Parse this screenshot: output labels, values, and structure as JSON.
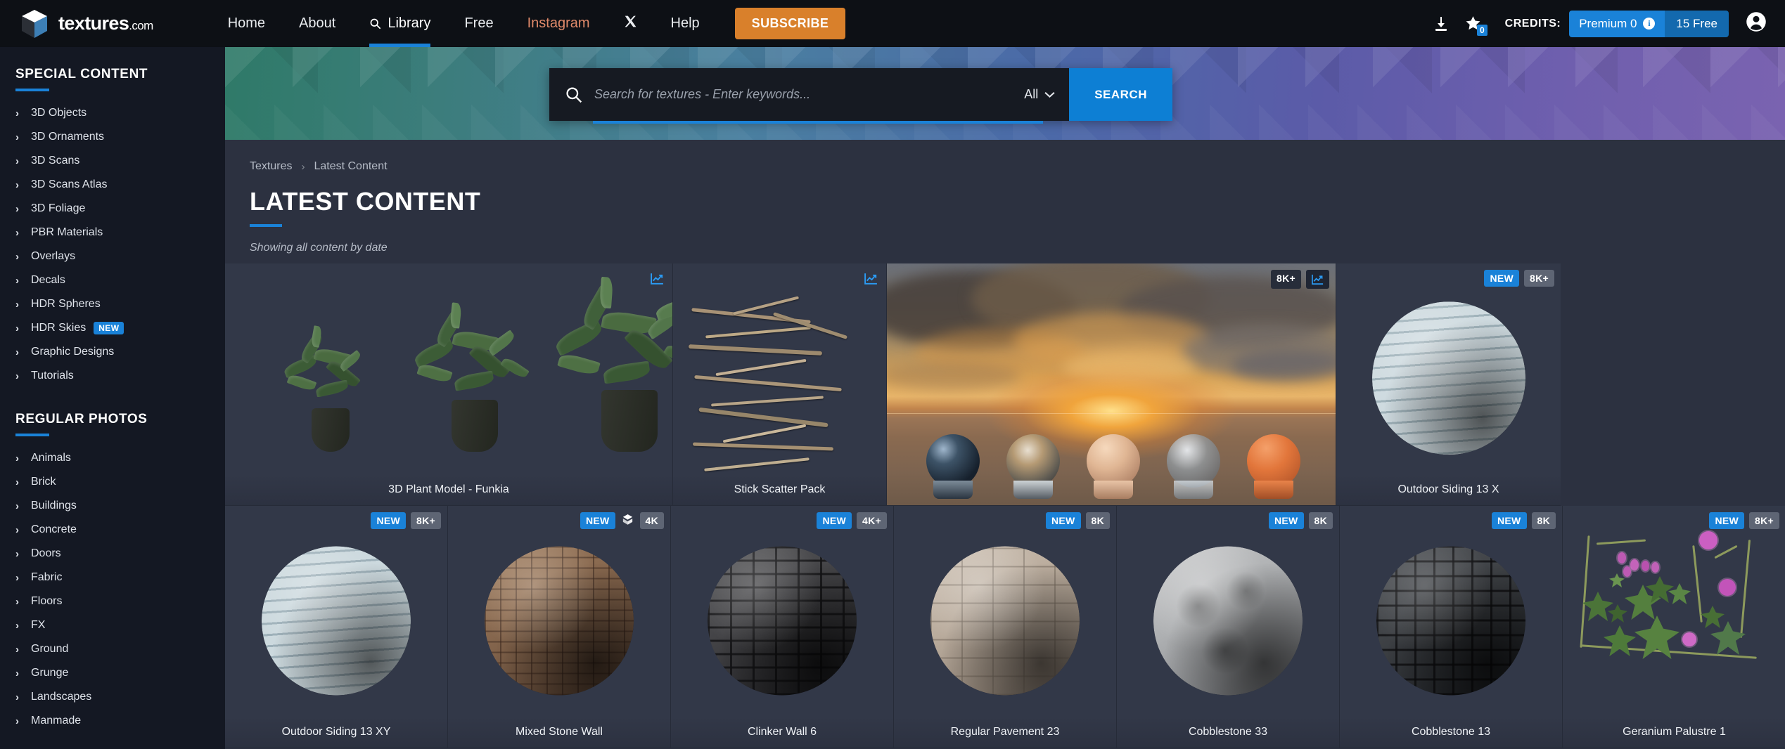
{
  "brand": {
    "name": "textures",
    "suffix": ".com",
    "logo_icon": "cube-logo-icon"
  },
  "nav": {
    "items": [
      {
        "label": "Home",
        "icon": null,
        "active": false
      },
      {
        "label": "About",
        "icon": null,
        "active": false
      },
      {
        "label": "Library",
        "icon": "search-icon",
        "active": true
      },
      {
        "label": "Free",
        "icon": null,
        "active": false
      },
      {
        "label": "Instagram",
        "icon": null,
        "active": false,
        "style": "instagram"
      },
      {
        "label": "",
        "icon": "x-twitter-icon",
        "active": false
      },
      {
        "label": "Help",
        "icon": null,
        "active": false
      }
    ],
    "subscribe_label": "SUBSCRIBE"
  },
  "header_right": {
    "download_icon": "download-icon",
    "favorites_icon": "star-icon",
    "favorites_count": "0",
    "credits_label": "CREDITS:",
    "premium_label": "Premium 0",
    "info_icon": "info-icon",
    "free_label": "15 Free",
    "account_icon": "account-icon"
  },
  "search": {
    "icon": "search-icon",
    "value": "",
    "placeholder": "Search for textures - Enter keywords...",
    "filter_label": "All",
    "filter_icon": "chevron-down-icon",
    "button_label": "SEARCH"
  },
  "sidebar": {
    "sections": [
      {
        "title": "SPECIAL CONTENT",
        "items": [
          {
            "label": "3D Objects"
          },
          {
            "label": "3D Ornaments"
          },
          {
            "label": "3D Scans"
          },
          {
            "label": "3D Scans Atlas"
          },
          {
            "label": "3D Foliage"
          },
          {
            "label": "PBR Materials"
          },
          {
            "label": "Overlays"
          },
          {
            "label": "Decals"
          },
          {
            "label": "HDR Spheres"
          },
          {
            "label": "HDR Skies",
            "tag": "NEW"
          },
          {
            "label": "Graphic Designs"
          },
          {
            "label": "Tutorials"
          }
        ]
      },
      {
        "title": "REGULAR PHOTOS",
        "items": [
          {
            "label": "Animals"
          },
          {
            "label": "Brick"
          },
          {
            "label": "Buildings"
          },
          {
            "label": "Concrete"
          },
          {
            "label": "Doors"
          },
          {
            "label": "Fabric"
          },
          {
            "label": "Floors"
          },
          {
            "label": "FX"
          },
          {
            "label": "Ground"
          },
          {
            "label": "Grunge"
          },
          {
            "label": "Landscapes"
          },
          {
            "label": "Manmade"
          }
        ]
      }
    ]
  },
  "breadcrumb": {
    "root": "Textures",
    "separator": "›",
    "current": "Latest Content"
  },
  "page": {
    "title": "LATEST CONTENT",
    "subtitle": "Showing all content by date"
  },
  "grid": {
    "row1": [
      {
        "title": "3D Plant Model - Funkia",
        "badges": [
          {
            "text": "",
            "type": "trend-icon"
          }
        ],
        "thumb": "plants"
      },
      {
        "title": "Stick Scatter Pack",
        "badges": [
          {
            "text": "",
            "type": "trend-icon"
          }
        ],
        "thumb": "sticks"
      },
      {
        "title": "",
        "badges": [
          {
            "text": "8K+",
            "type": "res"
          },
          {
            "text": "",
            "type": "trend-icon"
          }
        ],
        "thumb": "hdr-sky"
      },
      {
        "title": "Outdoor Siding 13 X",
        "badges": [
          {
            "text": "NEW",
            "type": "new"
          },
          {
            "text": "8K+",
            "type": "res"
          }
        ],
        "thumb": "sphere-siding"
      }
    ],
    "row2": [
      {
        "title": "Outdoor Siding 13 XY",
        "badges": [
          {
            "text": "NEW",
            "type": "new"
          },
          {
            "text": "8K+",
            "type": "res"
          }
        ],
        "thumb": "sphere-siding"
      },
      {
        "title": "Mixed Stone Wall",
        "badges": [
          {
            "text": "NEW",
            "type": "new"
          },
          {
            "text": "",
            "type": "material-icon"
          },
          {
            "text": "4K",
            "type": "res"
          }
        ],
        "thumb": "sphere-stone"
      },
      {
        "title": "Clinker Wall 6",
        "badges": [
          {
            "text": "NEW",
            "type": "new"
          },
          {
            "text": "4K+",
            "type": "res"
          }
        ],
        "thumb": "sphere-clinker"
      },
      {
        "title": "Regular Pavement 23",
        "badges": [
          {
            "text": "NEW",
            "type": "new"
          },
          {
            "text": "8K",
            "type": "res"
          }
        ],
        "thumb": "sphere-pavement"
      },
      {
        "title": "Cobblestone 33",
        "badges": [
          {
            "text": "NEW",
            "type": "new"
          },
          {
            "text": "8K",
            "type": "res"
          }
        ],
        "thumb": "sphere-cobble33"
      },
      {
        "title": "Cobblestone 13",
        "badges": [
          {
            "text": "NEW",
            "type": "new"
          },
          {
            "text": "8K",
            "type": "res"
          }
        ],
        "thumb": "sphere-cobble13"
      },
      {
        "title": "Geranium Palustre 1",
        "badges": [
          {
            "text": "NEW",
            "type": "new"
          },
          {
            "text": "8K+",
            "type": "res"
          }
        ],
        "thumb": "geranium"
      }
    ]
  },
  "colors": {
    "accent": "#1a82d8",
    "subscribe": "#d9802b",
    "nav_bg": "#0d1015",
    "sidebar_bg": "#141823",
    "main_bg": "#2c3140",
    "card_bg": "#323848",
    "instagram": "#e08a6a"
  }
}
